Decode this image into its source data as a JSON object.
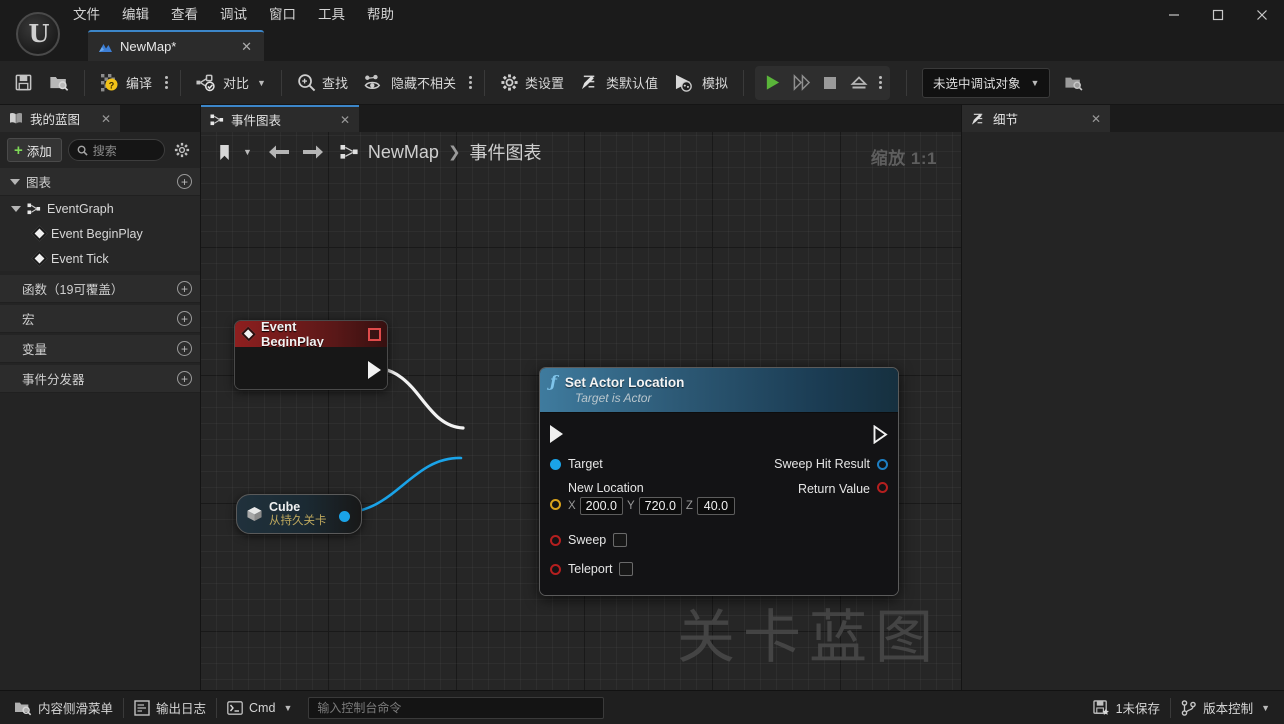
{
  "window": {
    "menus": [
      "文件",
      "编辑",
      "查看",
      "调试",
      "窗口",
      "工具",
      "帮助"
    ],
    "controls": {
      "minimize": "—",
      "maximize": "☐",
      "close": "✕"
    }
  },
  "document_tab": {
    "label": "NewMap*",
    "close": "✕",
    "icon": "blueprint-icon"
  },
  "toolbar": {
    "save_icon": "save-icon",
    "browse_icon": "browse-content-icon",
    "compile_label": "编译",
    "diff_label": "对比",
    "find_label": "查找",
    "hide_unrelated_label": "隐藏不相关",
    "class_settings_label": "类设置",
    "class_defaults_label": "类默认值",
    "simulate_label": "模拟",
    "play_icon": "play-icon",
    "step_icon": "step-forward-icon",
    "stop_icon": "stop-icon",
    "eject_icon": "eject-icon",
    "debug_object": "未选中调试对象",
    "debug_browse_icon": "debug-browse-icon"
  },
  "my_blueprint": {
    "tab_label": "我的蓝图",
    "tab_icon": "book-icon",
    "tab_close": "✕",
    "add_label": "添加",
    "search_placeholder": "搜索",
    "gear_icon": "gear-icon",
    "sections": [
      {
        "label": "图表",
        "expandable": true,
        "add": "+"
      },
      {
        "label": "函数（19可覆盖）",
        "expandable": false,
        "add": "+"
      },
      {
        "label": "宏",
        "expandable": false,
        "add": "+"
      },
      {
        "label": "变量",
        "expandable": false,
        "add": "+"
      },
      {
        "label": "事件分发器",
        "expandable": false,
        "add": "+"
      }
    ],
    "graph_root": "EventGraph",
    "graph_items": [
      "Event BeginPlay",
      "Event Tick"
    ]
  },
  "graph": {
    "tab_label": "事件图表",
    "tab_close": "✕",
    "tab_icon": "graph-icon",
    "bookmark_icon": "bookmark-icon",
    "back_icon": "arrow-left-icon",
    "forward_icon": "arrow-right-icon",
    "breadcrumb_icon": "graph-icon",
    "breadcrumb_root": "NewMap",
    "breadcrumb_sep": "❯",
    "breadcrumb_leaf": "事件图表",
    "zoom_label": "缩放 1:1",
    "watermark": "关卡蓝图"
  },
  "nodes": {
    "event_begin_play": {
      "title": "Event BeginPlay",
      "icon": "event-diamond-icon",
      "delegate_pin": "delegate-output-pin",
      "exec_out": "exec-output-pin"
    },
    "set_actor_location": {
      "title": "Set Actor Location",
      "subtitle": "Target is Actor",
      "icon": "function-f-icon",
      "exec_in": "exec-input-pin",
      "exec_out": "exec-output-pin",
      "inputs": [
        {
          "label": "Target",
          "pin": "object-pin-blue"
        },
        {
          "label": "New Location",
          "pin": "struct-pin-yellow"
        },
        {
          "label": "Sweep",
          "pin": "bool-pin-red",
          "checkbox": false
        },
        {
          "label": "Teleport",
          "pin": "bool-pin-red",
          "checkbox": false
        }
      ],
      "vector": {
        "x_axis": "X",
        "x": "200.0",
        "y_axis": "Y",
        "y": "720.0",
        "z_axis": "Z",
        "z": "40.0"
      },
      "outputs": [
        {
          "label": "Sweep Hit Result",
          "pin": "struct-pin-blue"
        },
        {
          "label": "Return Value",
          "pin": "bool-pin-red"
        }
      ]
    },
    "cube_ref": {
      "title": "Cube",
      "subtitle": "从持久关卡",
      "icon": "cube-icon",
      "out_pin": "object-pin-blue"
    }
  },
  "details": {
    "tab_label": "细节",
    "tab_icon": "details-icon",
    "tab_close": "✕"
  },
  "statusbar": {
    "content_drawer": "内容侧滑菜单",
    "content_drawer_icon": "content-drawer-icon",
    "output_log": "输出日志",
    "output_log_icon": "output-log-icon",
    "cmd_label": "Cmd",
    "cmd_icon": "console-icon",
    "cmd_placeholder": "输入控制台命令",
    "unsaved_label": "1未保存",
    "unsaved_icon": "unsaved-icon",
    "source_control": "版本控制",
    "source_control_icon": "source-control-icon"
  },
  "colors": {
    "accent_tab": "#3c86c9",
    "exec_wire": "#f2f2f2",
    "object_wire": "#1aa3e8",
    "event_header": "#8e1f1f",
    "function_header": "#3f7b9e",
    "add_plus": "#7ed957",
    "play_green": "#5ab53a"
  }
}
